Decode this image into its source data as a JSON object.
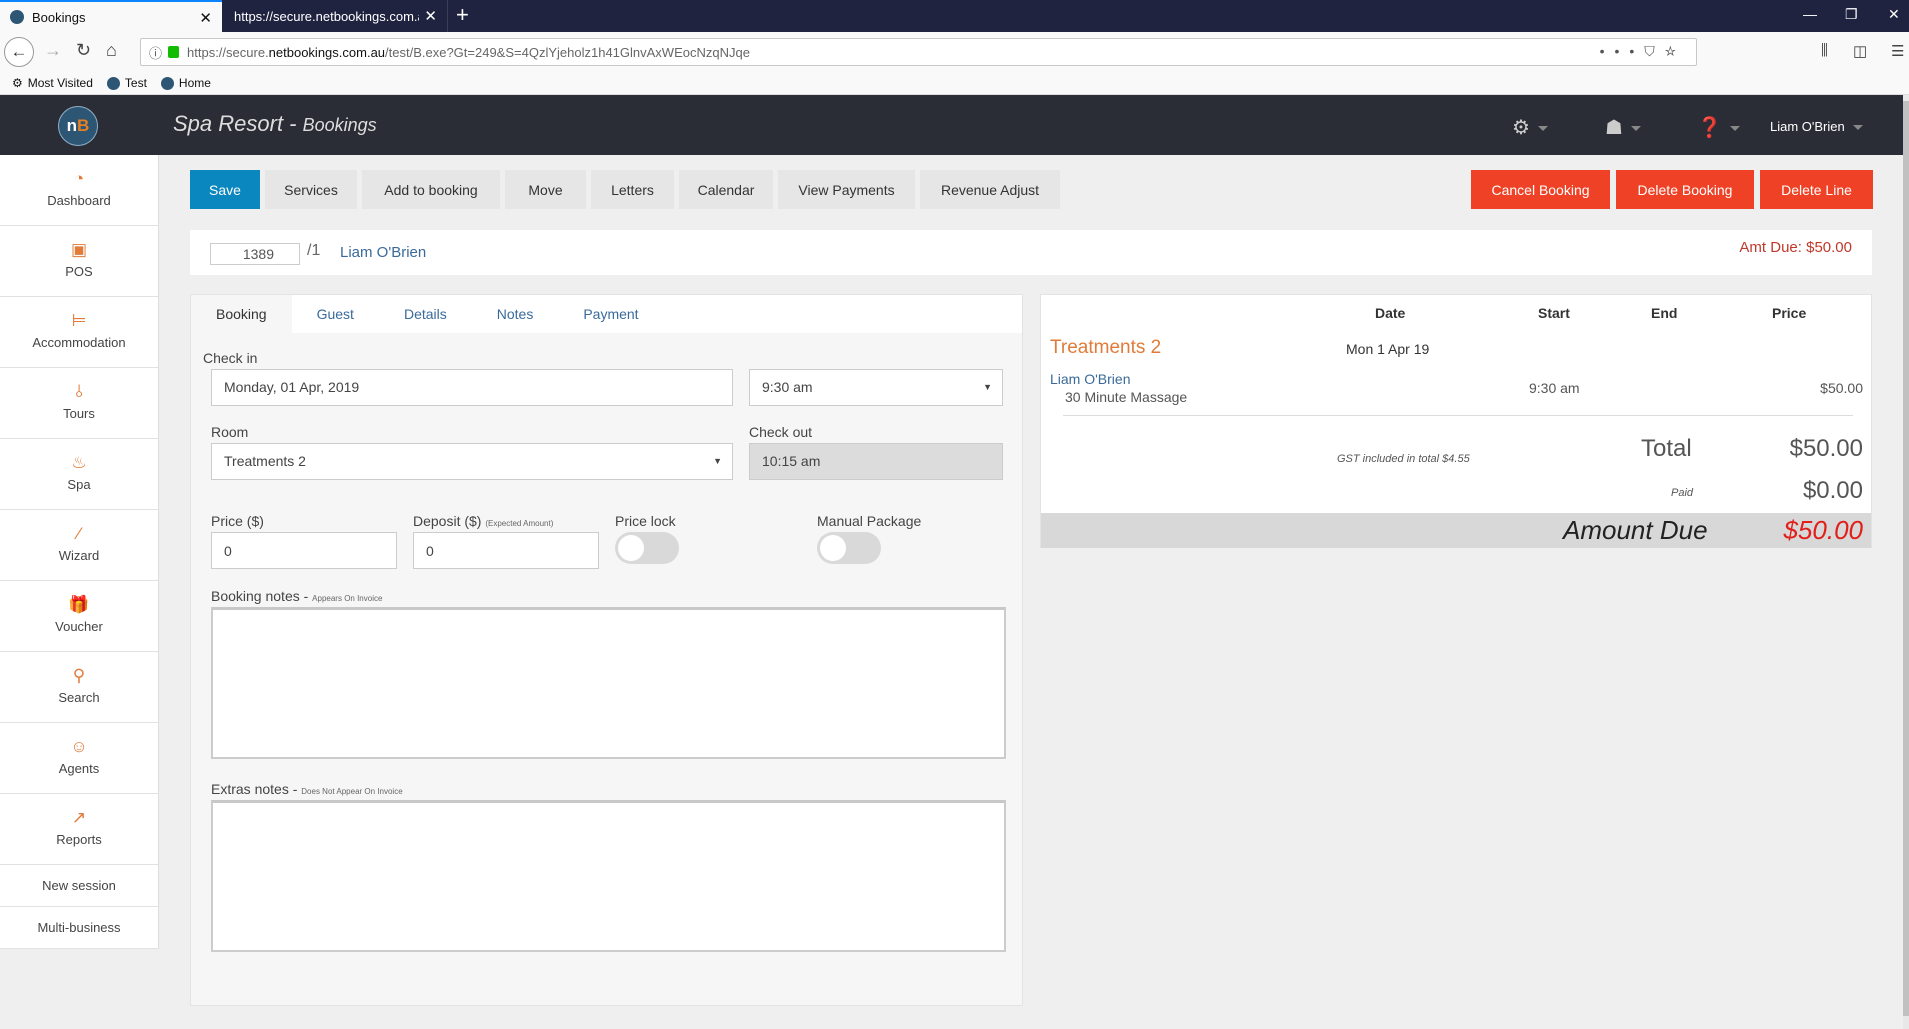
{
  "browser": {
    "tabs": [
      {
        "title": "Bookings",
        "active": true
      },
      {
        "title": "https://secure.netbookings.com.au",
        "active": false
      }
    ],
    "new_tab": "+",
    "url": {
      "scheme": "https://secure.",
      "host": "netbookings.com.au",
      "path": "/test/B.exe?Gt=249&S=4QzlYjeholz1h41GlnvAxWEocNzqNJqe"
    },
    "bookmarks": [
      "Most Visited",
      "Test",
      "Home"
    ]
  },
  "app": {
    "logo_text_a": "n",
    "logo_text_b": "B",
    "title": "Spa Resort",
    "title_sep": " - ",
    "subtitle": "Bookings",
    "user_name": "Liam O'Brien"
  },
  "sidebar": {
    "items": [
      {
        "label": "Dashboard",
        "icon": "dashboard-icon",
        "glyph": "◔"
      },
      {
        "label": "POS",
        "icon": "pos-icon",
        "glyph": "▣"
      },
      {
        "label": "Accommodation",
        "icon": "bed-icon",
        "glyph": "⊨"
      },
      {
        "label": "Tours",
        "icon": "route-icon",
        "glyph": "⫰"
      },
      {
        "label": "Spa",
        "icon": "massage-icon",
        "glyph": "♨"
      },
      {
        "label": "Wizard",
        "icon": "magic-wand-icon",
        "glyph": "⁄"
      },
      {
        "label": "Voucher",
        "icon": "gift-icon",
        "glyph": "🎁"
      },
      {
        "label": "Search",
        "icon": "search-icon",
        "glyph": "⚲"
      },
      {
        "label": "Agents",
        "icon": "agent-icon",
        "glyph": "☺"
      },
      {
        "label": "Reports",
        "icon": "chart-icon",
        "glyph": "↗"
      }
    ],
    "links": [
      "New session",
      "Multi-business"
    ]
  },
  "toolbar": {
    "save": "Save",
    "services": "Services",
    "add_to_booking": "Add to booking",
    "move": "Move",
    "letters": "Letters",
    "calendar": "Calendar",
    "view_payments": "View Payments",
    "revenue_adjust": "Revenue Adjust",
    "cancel_booking": "Cancel Booking",
    "delete_booking": "Delete Booking",
    "delete_line": "Delete Line"
  },
  "booking": {
    "id": "1389",
    "suffix": "/1",
    "guest_name": "Liam O'Brien",
    "amt_due": "Amt Due: $50.00"
  },
  "form": {
    "tabs": [
      "Booking",
      "Guest",
      "Details",
      "Notes",
      "Payment"
    ],
    "active_tab": "Booking",
    "check_in_label": "Check in",
    "check_in_date": "Monday, 01 Apr, 2019",
    "check_in_time": "9:30 am",
    "room_label": "Room",
    "room": "Treatments 2",
    "check_out_label": "Check out",
    "check_out_time": "10:15 am",
    "price_label": "Price ($)",
    "price": "0",
    "deposit_label": "Deposit ($)",
    "deposit_note": "(Expected Amount)",
    "deposit": "0",
    "price_lock_label": "Price lock",
    "price_lock": false,
    "manual_package_label": "Manual Package",
    "manual_package": false,
    "booking_notes_label": "Booking notes - ",
    "booking_notes_note": "Appears On Invoice",
    "booking_notes": "",
    "extras_notes_label": "Extras notes - ",
    "extras_notes_note": "Does Not Appear On Invoice",
    "extras_notes": ""
  },
  "summary": {
    "headers": {
      "date": "Date",
      "start": "Start",
      "end": "End",
      "price": "Price"
    },
    "room": "Treatments 2",
    "date": "Mon 1 Apr 19",
    "lines": [
      {
        "guest": "Liam O'Brien",
        "service": "30 Minute Massage",
        "start": "9:30 am",
        "end": "",
        "price": "$50.00"
      }
    ],
    "gst_note": "GST included in total $4.55",
    "total_label": "Total",
    "total": "$50.00",
    "paid_label": "Paid",
    "paid": "$0.00",
    "amount_due_label": "Amount Due",
    "amount_due": "$50.00"
  },
  "colors": {
    "primary": "#0b87bf",
    "danger": "#ee4125",
    "accent": "#e07b39",
    "header_bg": "#2b2d36",
    "due": "#e0201b"
  }
}
